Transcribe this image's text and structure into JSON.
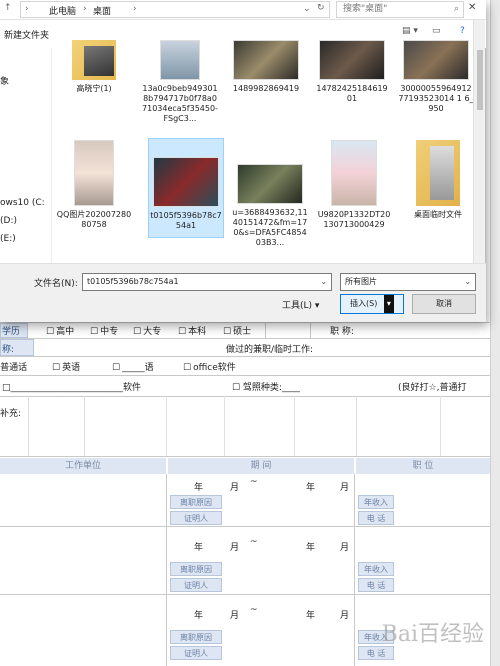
{
  "dialog": {
    "address": {
      "path": [
        "此电脑",
        "桌面"
      ],
      "search_placeholder": "搜索\"桌面\""
    },
    "toolbar": {
      "new_folder": "新建文件夹"
    },
    "left_pane": {
      "items": [
        "象",
        "ows10 (C:",
        "(D:)",
        "(E:)"
      ]
    },
    "files": [
      {
        "name": "高晓宁(1)",
        "type": "folder"
      },
      {
        "name": "13a0c9beb9493018b794717b0f78a071034eca5f35450-FSgC3...",
        "type": "image"
      },
      {
        "name": "1489982869419",
        "type": "image"
      },
      {
        "name": "1478242518461901",
        "type": "image"
      },
      {
        "name": "3000005596491277193523014 1 6_950",
        "type": "image"
      },
      {
        "name": "QQ图片20200728080758",
        "type": "image"
      },
      {
        "name": "t0105f5396b78c754a1",
        "type": "image",
        "selected": true
      },
      {
        "name": "u=3688493632,1140151472&fm=170&s=DFA5FC485403B3...",
        "type": "image"
      },
      {
        "name": "U9820P1332DT20130713000429",
        "type": "image"
      },
      {
        "name": "桌面临时文件",
        "type": "folder"
      }
    ],
    "filename_label": "文件名(N):",
    "filename_value": "t0105f5396b78c754a1",
    "filetype_value": "所有图片",
    "tools_label": "工具(L)",
    "insert_label": "插入(S)",
    "cancel_label": "取消"
  },
  "form": {
    "education_label": "学历",
    "education_options": [
      "高中",
      "中专",
      "大专",
      "本科",
      "硕士"
    ],
    "title_label": "职 称:",
    "prev_label": "称:",
    "parttime_label": "做过的兼职/临时工作:",
    "language_row": [
      "普通话",
      "英语",
      "_____语",
      "office软件"
    ],
    "software_line": "□_________________________软件",
    "driving_label": "☐  驾照种类:____",
    "rating_label": "(良好打☆,普通打",
    "supplement_label": "补充:",
    "work_header": {
      "unit": "工作单位",
      "period": "期    间",
      "position": "职    位"
    },
    "period_row": {
      "year": "年",
      "month": "月",
      "tilde": "~",
      "year2": "年",
      "month2": "月"
    },
    "leave_reason": "离职原因",
    "witness": "证明人",
    "annual_income": "年收入",
    "phone": "电    话"
  },
  "watermark": "Bai百经验"
}
